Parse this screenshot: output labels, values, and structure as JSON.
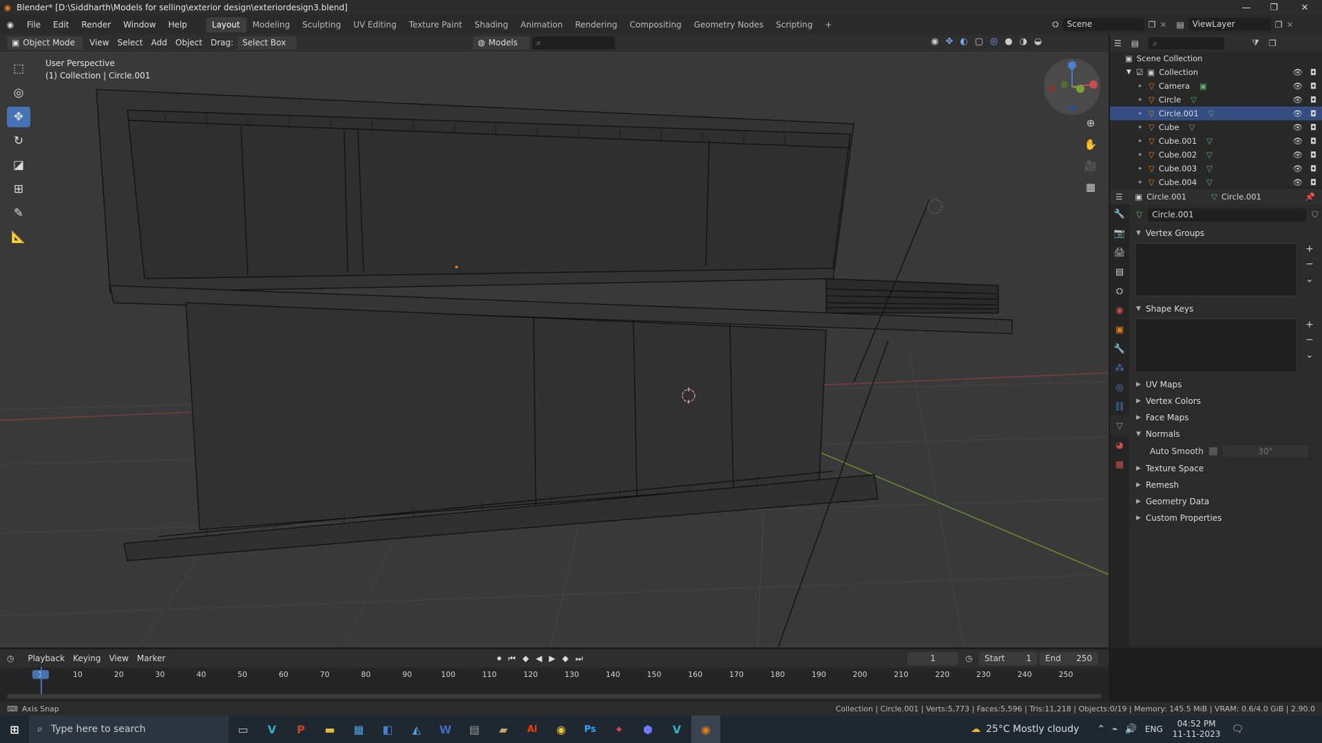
{
  "window": {
    "title": "Blender* [D:\\Siddharth\\Models for selling\\exterior design\\exteriordesign3.blend]",
    "minimize": "—",
    "maximize": "❐",
    "close": "✕"
  },
  "menubar": {
    "items": [
      "File",
      "Edit",
      "Render",
      "Window",
      "Help"
    ],
    "workspaces": [
      "Layout",
      "Modeling",
      "Sculpting",
      "UV Editing",
      "Texture Paint",
      "Shading",
      "Animation",
      "Rendering",
      "Compositing",
      "Geometry Nodes",
      "Scripting"
    ],
    "add_tab": "+",
    "scene_label": "Scene",
    "view_layer_label": "ViewLayer"
  },
  "viewport_header": {
    "mode": "Object Mode",
    "menu": [
      "View",
      "Select",
      "Add",
      "Object"
    ],
    "drag_label": "Drag:",
    "drag_value": "Select Box",
    "models_label": "Models",
    "search_placeholder": "⌕"
  },
  "viewport": {
    "perspective_label": "User Perspective",
    "collection_label": "(1) Collection | Circle.001",
    "gizmo": {
      "x": "X",
      "y": "Y",
      "z": "Z"
    }
  },
  "outliner": {
    "scene_collection": "Scene Collection",
    "collection": "Collection",
    "items": [
      {
        "name": "Camera",
        "type": "camera"
      },
      {
        "name": "Circle",
        "type": "mesh"
      },
      {
        "name": "Circle.001",
        "type": "mesh",
        "selected": true
      },
      {
        "name": "Cube",
        "type": "mesh"
      },
      {
        "name": "Cube.001",
        "type": "mesh"
      },
      {
        "name": "Cube.002",
        "type": "mesh"
      },
      {
        "name": "Cube.003",
        "type": "mesh"
      },
      {
        "name": "Cube.004",
        "type": "mesh"
      }
    ]
  },
  "properties": {
    "header_object": "Circle.001",
    "header_mesh": "Circle.001",
    "mesh_name": "Circle.001",
    "sections": {
      "vertex_groups": "Vertex Groups",
      "shape_keys": "Shape Keys",
      "uv_maps": "UV Maps",
      "vertex_colors": "Vertex Colors",
      "face_maps": "Face Maps",
      "normals": "Normals",
      "auto_smooth": "Auto Smooth",
      "auto_smooth_angle": "30°",
      "texture_space": "Texture Space",
      "remesh": "Remesh",
      "geometry_data": "Geometry Data",
      "custom_properties": "Custom Properties"
    }
  },
  "timeline": {
    "menu": [
      "Playback",
      "Keying",
      "View",
      "Marker"
    ],
    "current_frame": "1",
    "start_label": "Start",
    "start_value": "1",
    "end_label": "End",
    "end_value": "250",
    "ruler": [
      "1",
      "10",
      "20",
      "30",
      "40",
      "50",
      "60",
      "70",
      "80",
      "90",
      "100",
      "110",
      "120",
      "130",
      "140",
      "150",
      "160",
      "170",
      "180",
      "190",
      "200",
      "210",
      "220",
      "230",
      "240",
      "250"
    ]
  },
  "statusbar": {
    "left": "Axis Snap",
    "right": "Collection | Circle.001 | Verts:5,773 | Faces:5,596 | Tris:11,218 | Objects:0/19 | Memory: 145.5 MiB | VRAM: 0.6/4.0 GiB | 2.90.0"
  },
  "taskbar": {
    "search_placeholder": "Type here to search",
    "weather": "25°C  Mostly cloudy",
    "lang": "ENG",
    "time": "04:52 PM",
    "date": "11-11-2023"
  },
  "colors": {
    "accent": "#4772b3",
    "blender_orange": "#e87d0d",
    "selection": "#334d80",
    "x_axis": "#c84d4d",
    "y_axis": "#7aa33d",
    "mesh_green": "#5db37a"
  }
}
